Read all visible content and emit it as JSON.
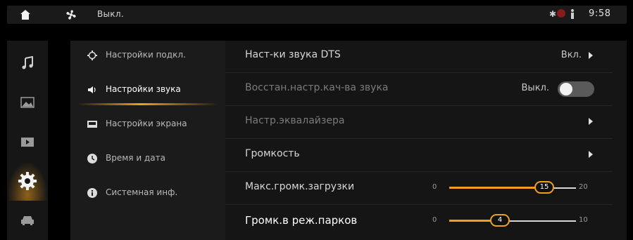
{
  "status_bar": {
    "fan_label": "Выкл.",
    "clock": "9:58",
    "icons": [
      "home-icon",
      "fan-icon",
      "bluetooth-icon",
      "status-circle-icon",
      "person-icon"
    ],
    "bluetooth_glyph": "✱"
  },
  "rail": {
    "icons": [
      "music-icon",
      "gallery-icon",
      "video-icon",
      "settings-icon",
      "car-icon"
    ],
    "active_index": 3
  },
  "categories": [
    {
      "label": "Настройки подкл.",
      "icon": "connection-icon"
    },
    {
      "label": "Настройки звука",
      "icon": "speaker-icon",
      "active": true
    },
    {
      "label": "Настройки экрана",
      "icon": "screen-icon"
    },
    {
      "label": "Время и дата",
      "icon": "clock-icon"
    },
    {
      "label": "Системная инф.",
      "icon": "info-icon"
    }
  ],
  "settings": {
    "dts": {
      "label": "Наст-ки звука DTS",
      "value": "Вкл."
    },
    "restore_quality": {
      "label": "Восстан.настр.кач-ва звука",
      "value": "Выкл.",
      "toggle_on": false
    },
    "equalizer": {
      "label": "Настр.эквалайзера"
    },
    "volume": {
      "label": "Громкость"
    },
    "max_boot_volume": {
      "label": "Макс.громк.загрузки",
      "min": "0",
      "max": "20",
      "value": "15",
      "numeric": 15,
      "range": [
        0,
        20
      ]
    },
    "parking_volume": {
      "label": "Громк.в реж.парков",
      "min": "0",
      "max": "10",
      "value": "4",
      "numeric": 4,
      "range": [
        0,
        10
      ]
    }
  },
  "colors": {
    "accent": "#f0a020",
    "background": "#000000",
    "panel": "#1b1b1b",
    "list": "#151515"
  }
}
